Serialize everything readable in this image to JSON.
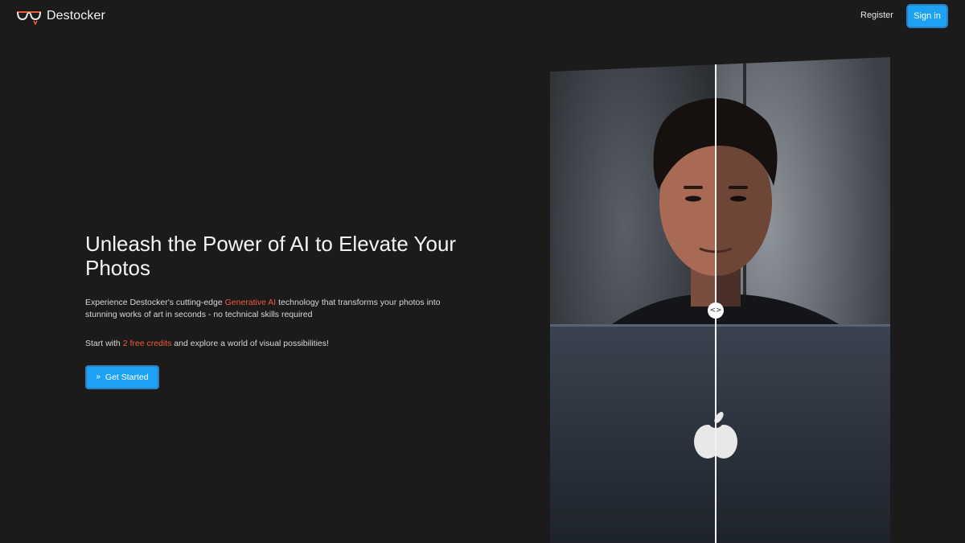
{
  "header": {
    "brand": "Destocker",
    "logo_icon": "glasses-icon",
    "register_label": "Register",
    "signin_label": "Sign in"
  },
  "hero": {
    "title": "Unleash the Power of AI to Elevate Your Photos",
    "description_pre": "Experience Destocker's cutting-edge ",
    "description_accent": "Generative AI",
    "description_post": " technology that transforms your photos into stunning works of art in seconds - no technical skills required",
    "credits_pre": "Start with ",
    "credits_accent": "2 free credits",
    "credits_post": " and explore a world of visual possibilities!",
    "cta_icon": "double-chevron-right-icon",
    "cta_label": "Get Started"
  },
  "comparison": {
    "handle_icon": "code-brackets-icon",
    "handle_glyph": "<>"
  },
  "colors": {
    "background": "#1b1b1b",
    "accent": "#ef5b38",
    "button": "#1da1f2"
  }
}
